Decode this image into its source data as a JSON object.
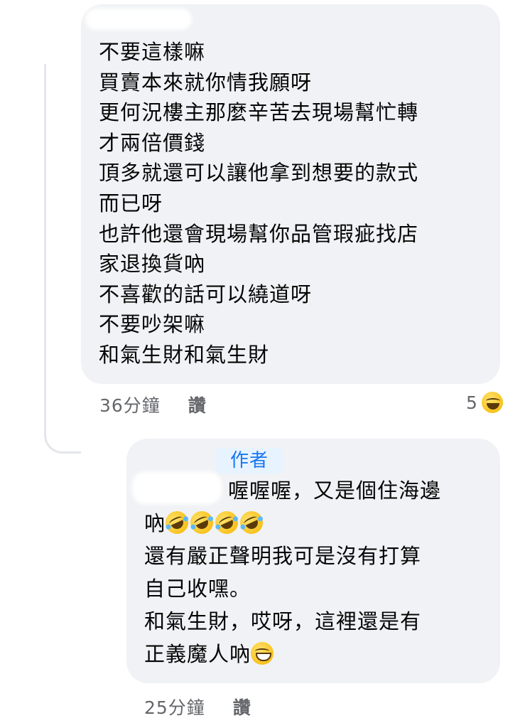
{
  "comments": [
    {
      "lines": [
        "不要這樣嘛",
        "買賣本來就你情我願呀",
        "更何況樓主那麼辛苦去現場幫忙轉",
        "才兩倍價錢",
        "頂多就還可以讓他拿到想要的款式",
        "而已呀",
        "也許他還會現場幫你品管瑕疵找店",
        "家退換貨吶",
        "不喜歡的話可以繞道呀",
        "不要吵架嘛",
        "和氣生財和氣生財"
      ],
      "time": "36分鐘",
      "like_label": "讚",
      "reaction_count": "5",
      "reaction_icon": "laughing-emoji-icon"
    },
    {
      "badge": "作者",
      "line1": "喔喔喔，又是個住海邊",
      "line2": "吶",
      "line2_emojis": [
        "rofl-emoji-icon",
        "rofl-emoji-icon",
        "rofl-emoji-icon",
        "rofl-emoji-icon"
      ],
      "line3": "還有嚴正聲明我可是沒有打算",
      "line4": "自己收嘿。",
      "line5": "和氣生財，哎呀，這裡還是有",
      "line6": "正義魔人吶",
      "line6_emoji": "grinning-emoji-icon",
      "time": "25分鐘",
      "like_label": "讚"
    }
  ],
  "colors": {
    "bubble": "#f0f2f5",
    "meta_text": "#65676b",
    "badge_bg": "#e7f3ff",
    "badge_text": "#1877f2",
    "thread_line": "#e4e6eb"
  }
}
